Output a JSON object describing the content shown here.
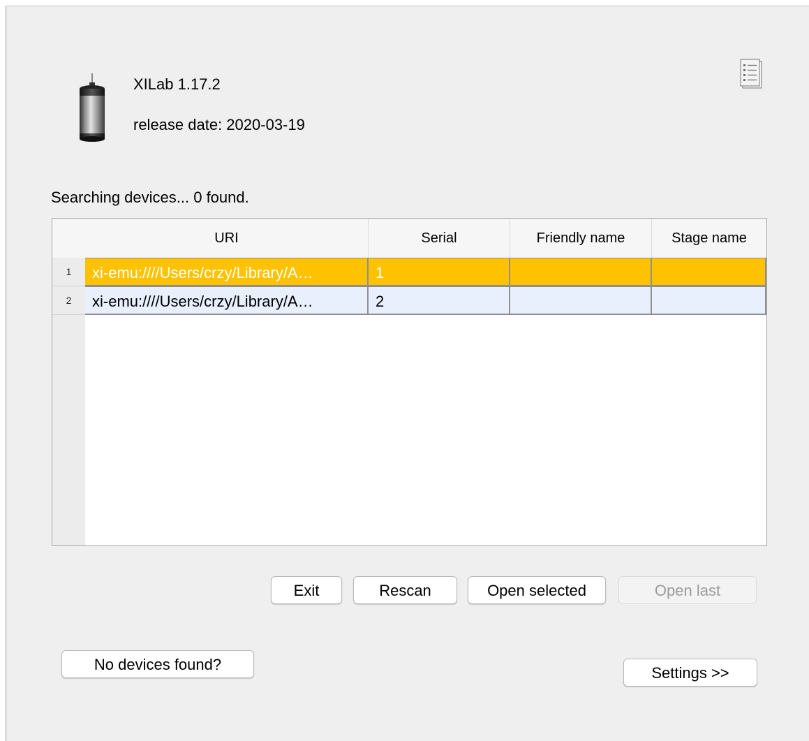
{
  "app": {
    "title": "XILab 1.17.2",
    "release_date": "release date: 2020-03-19"
  },
  "status": "Searching devices... 0 found.",
  "table": {
    "columns": [
      "URI",
      "Serial",
      "Friendly name",
      "Stage name"
    ],
    "rows": [
      {
        "num": "1",
        "uri": "xi-emu:////Users/crzy/Library/A…",
        "serial": "1",
        "friendly_name": "",
        "stage_name": "",
        "selected": true
      },
      {
        "num": "2",
        "uri": "xi-emu:////Users/crzy/Library/A…",
        "serial": "2",
        "friendly_name": "",
        "stage_name": "",
        "selected": false
      }
    ]
  },
  "buttons": {
    "exit": "Exit",
    "rescan": "Rescan",
    "open_selected": "Open selected",
    "open_last": "Open last",
    "no_devices": "No devices found?",
    "settings": "Settings >>"
  },
  "icons": {
    "app_icon": "motor-icon",
    "notes_icon": "notes-icon"
  },
  "colors": {
    "selected_row": "#ffc200",
    "normal_row": "#e9f0fd"
  }
}
